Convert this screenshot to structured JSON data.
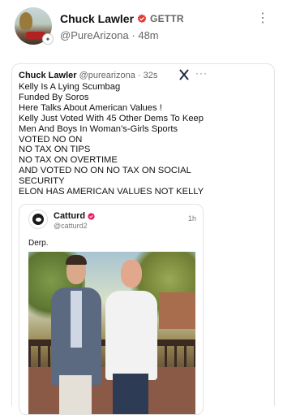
{
  "post": {
    "display_name": "Chuck Lawler",
    "platform": "GETTR",
    "handle": "@PureArizona",
    "separator": "·",
    "time": "48m"
  },
  "quoted_post": {
    "display_name": "Chuck Lawler",
    "handle": "@purearizona",
    "separator": "·",
    "time": "32s",
    "lines": [
      "Kelly Is A Lying Scumbag",
      "Funded By Soros",
      "Here Talks About American Values !",
      "Kelly Just Voted With 45 Other Dems To Keep",
      "Men And Boys In Woman’s-Girls Sports",
      "VOTED NO ON",
      "NO TAX ON TIPS",
      "NO TAX ON OVERTIME",
      "AND VOTED NO ON NO TAX ON SOCIAL",
      "SECURITY",
      "ELON HAS AMERICAN VALUES NOT KELLY"
    ]
  },
  "embedded_post": {
    "display_name": "Catturd",
    "handle": "@catturd2",
    "time": "1h",
    "text": "Derp."
  },
  "colors": {
    "verified_red": "#e53935",
    "verified_pink": "#e91e63"
  }
}
